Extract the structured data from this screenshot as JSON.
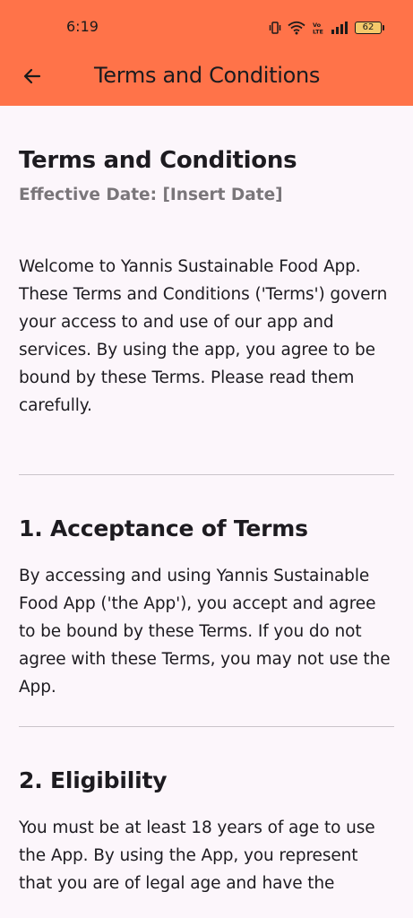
{
  "status_bar": {
    "time": "6:19",
    "battery_level": "62",
    "icons": [
      "vibrate-icon",
      "wifi-icon",
      "volte-icon",
      "signal-icon",
      "battery-icon"
    ]
  },
  "app_bar": {
    "back_icon": "arrow-left-icon",
    "title": "Terms and Conditions",
    "background_color": "#ff7349"
  },
  "document": {
    "title": "Terms and Conditions",
    "effective_date": "Effective Date: [Insert Date]",
    "intro": "Welcome to Yannis Sustainable Food App. These Terms and Conditions ('Terms') govern your access to and use of our app and services. By using the app, you agree to be bound by these Terms. Please read them carefully.",
    "sections": [
      {
        "heading": "1. Acceptance of Terms",
        "body": "By accessing and using Yannis Sustainable Food App ('the App'), you accept and agree to be bound by these Terms. If you do not agree with these Terms, you may not use the App."
      },
      {
        "heading": "2. Eligibility",
        "body": "You must be at least 18 years of age to use the App. By using the App, you represent that you are of legal age and have the"
      }
    ]
  }
}
